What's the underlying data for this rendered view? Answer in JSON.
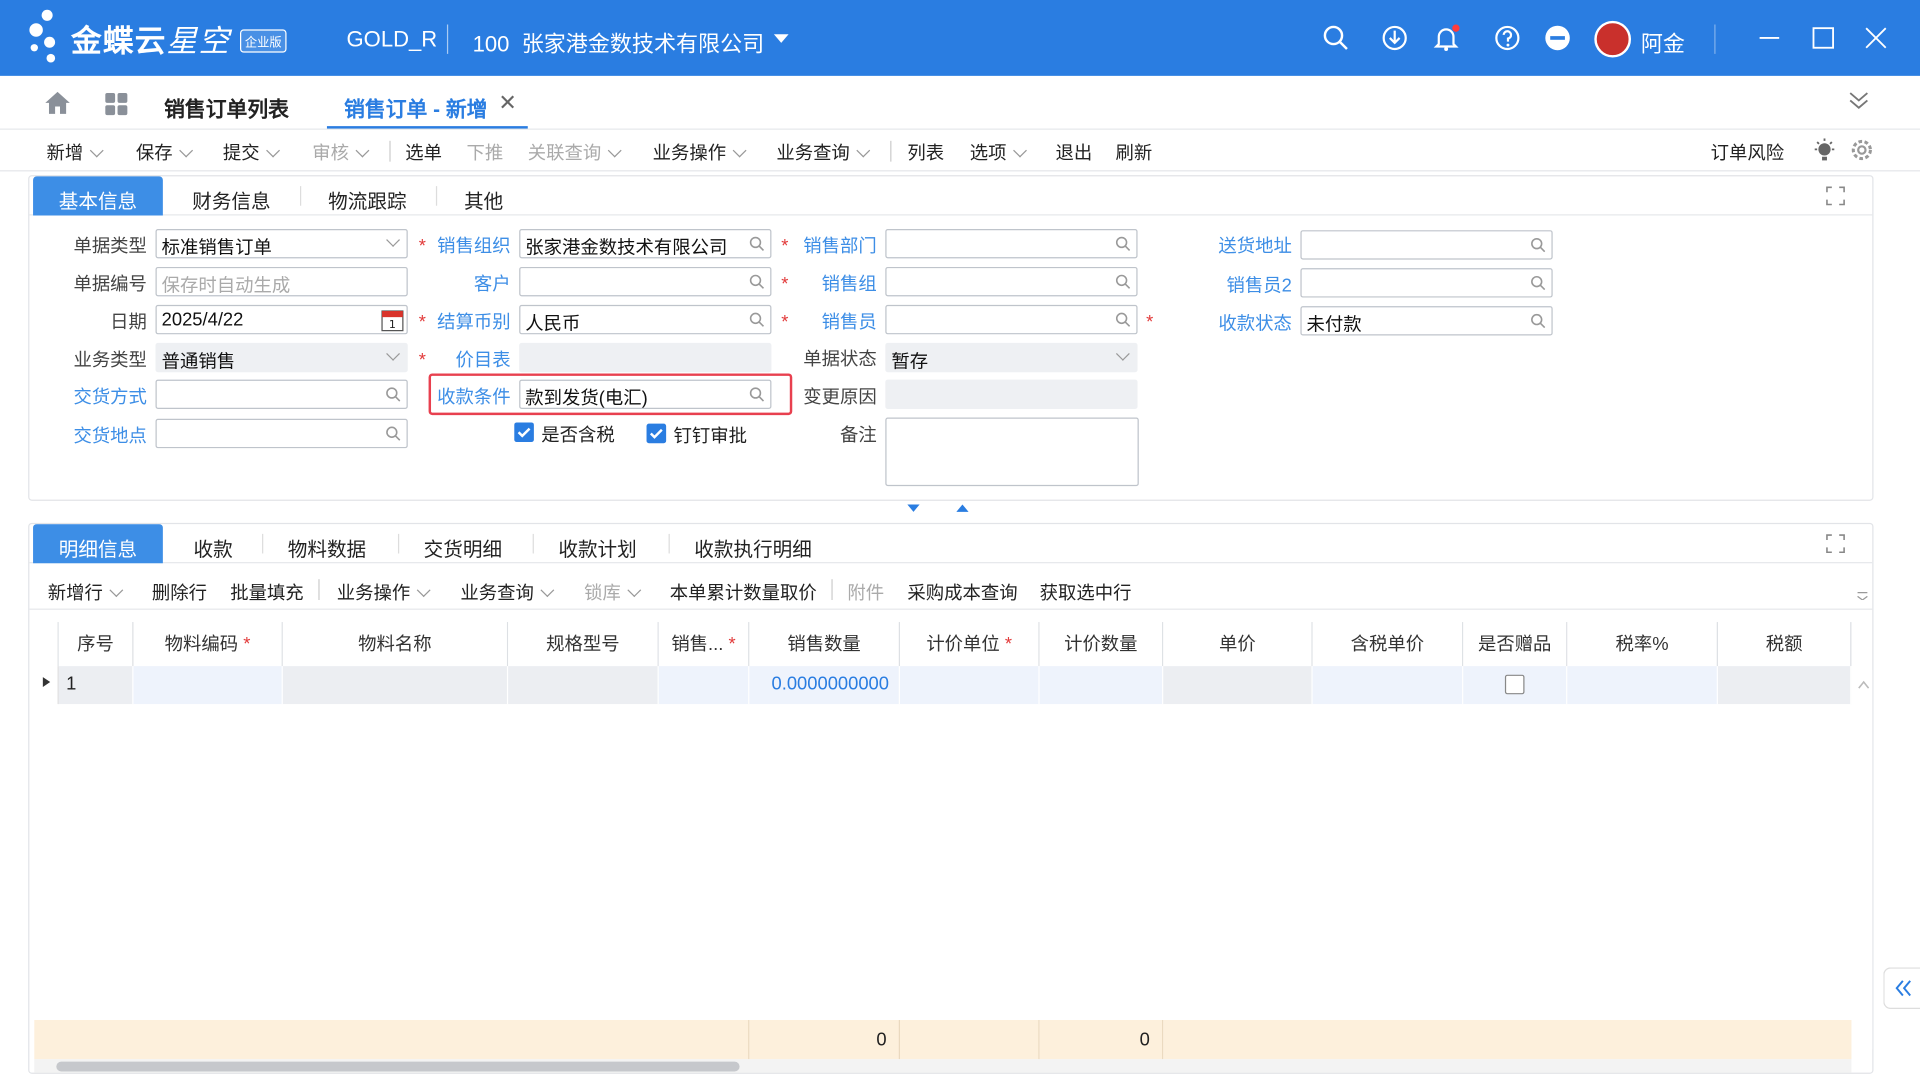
{
  "header": {
    "brand": "金蝶云",
    "brand_sub": "星空",
    "edition": "企业版",
    "env": "GOLD_R",
    "org_code": "100",
    "org_name": "张家港金数技术有限公司",
    "user": "阿金",
    "colors": {
      "primary": "#2a7de1",
      "active_tab": "#3d8ee6",
      "required": "#e23b3b",
      "highlight": "#e8404f",
      "footer": "#fdf0dc"
    }
  },
  "tabs": {
    "list_tab": "销售订单列表",
    "active_tab": "销售订单 - 新增"
  },
  "toolbar": {
    "items": [
      "新增",
      "保存",
      "提交",
      "审核",
      "选单",
      "下推",
      "关联查询",
      "业务操作",
      "业务查询",
      "列表",
      "选项",
      "退出",
      "刷新"
    ],
    "right": "订单风险"
  },
  "form": {
    "tabs": [
      "基本信息",
      "财务信息",
      "物流跟踪",
      "其他"
    ],
    "doc_type": {
      "label": "单据类型",
      "value": "标准销售订单"
    },
    "doc_no": {
      "label": "单据编号",
      "placeholder": "保存时自动生成"
    },
    "date": {
      "label": "日期",
      "value": "2025/4/22",
      "cal_day": "1"
    },
    "biz_type": {
      "label": "业务类型",
      "value": "普通销售"
    },
    "delivery_method": {
      "label": "交货方式",
      "value": ""
    },
    "delivery_place": {
      "label": "交货地点",
      "value": ""
    },
    "sales_org": {
      "label": "销售组织",
      "value": "张家港金数技术有限公司"
    },
    "customer": {
      "label": "客户",
      "value": ""
    },
    "currency": {
      "label": "结算币别",
      "value": "人民币"
    },
    "price_list": {
      "label": "价目表",
      "value": ""
    },
    "pay_terms": {
      "label": "收款条件",
      "value": "款到发货(电汇)"
    },
    "tax_included": {
      "label": "是否含税",
      "checked": true
    },
    "dingtalk": {
      "label": "钉钉审批",
      "checked": true
    },
    "sales_dept": {
      "label": "销售部门",
      "value": ""
    },
    "sales_group": {
      "label": "销售组",
      "value": ""
    },
    "salesman": {
      "label": "销售员",
      "value": ""
    },
    "doc_status": {
      "label": "单据状态",
      "value": "暂存"
    },
    "change_reason": {
      "label": "变更原因",
      "value": ""
    },
    "remark": {
      "label": "备注",
      "value": ""
    },
    "ship_addr": {
      "label": "送货地址",
      "value": ""
    },
    "salesman2": {
      "label": "销售员2",
      "value": ""
    },
    "collect_status": {
      "label": "收款状态",
      "value": "未付款"
    }
  },
  "detail": {
    "tabs": [
      "明细信息",
      "收款",
      "物料数据",
      "交货明细",
      "收款计划",
      "收款执行明细"
    ],
    "toolbar": [
      "新增行",
      "删除行",
      "批量填充",
      "业务操作",
      "业务查询",
      "锁库",
      "本单累计数量取价",
      "附件",
      "采购成本查询",
      "获取选中行"
    ],
    "columns": [
      "序号",
      "物料编码",
      "物料名称",
      "规格型号",
      "销售...",
      "销售数量",
      "计价单位",
      "计价数量",
      "单价",
      "含税单价",
      "是否赠品",
      "税率%",
      "税额"
    ],
    "row": {
      "seq": "1",
      "qty": "0.0000000000"
    },
    "footer": {
      "qty_sum": "0",
      "price_qty_sum": "0"
    }
  }
}
